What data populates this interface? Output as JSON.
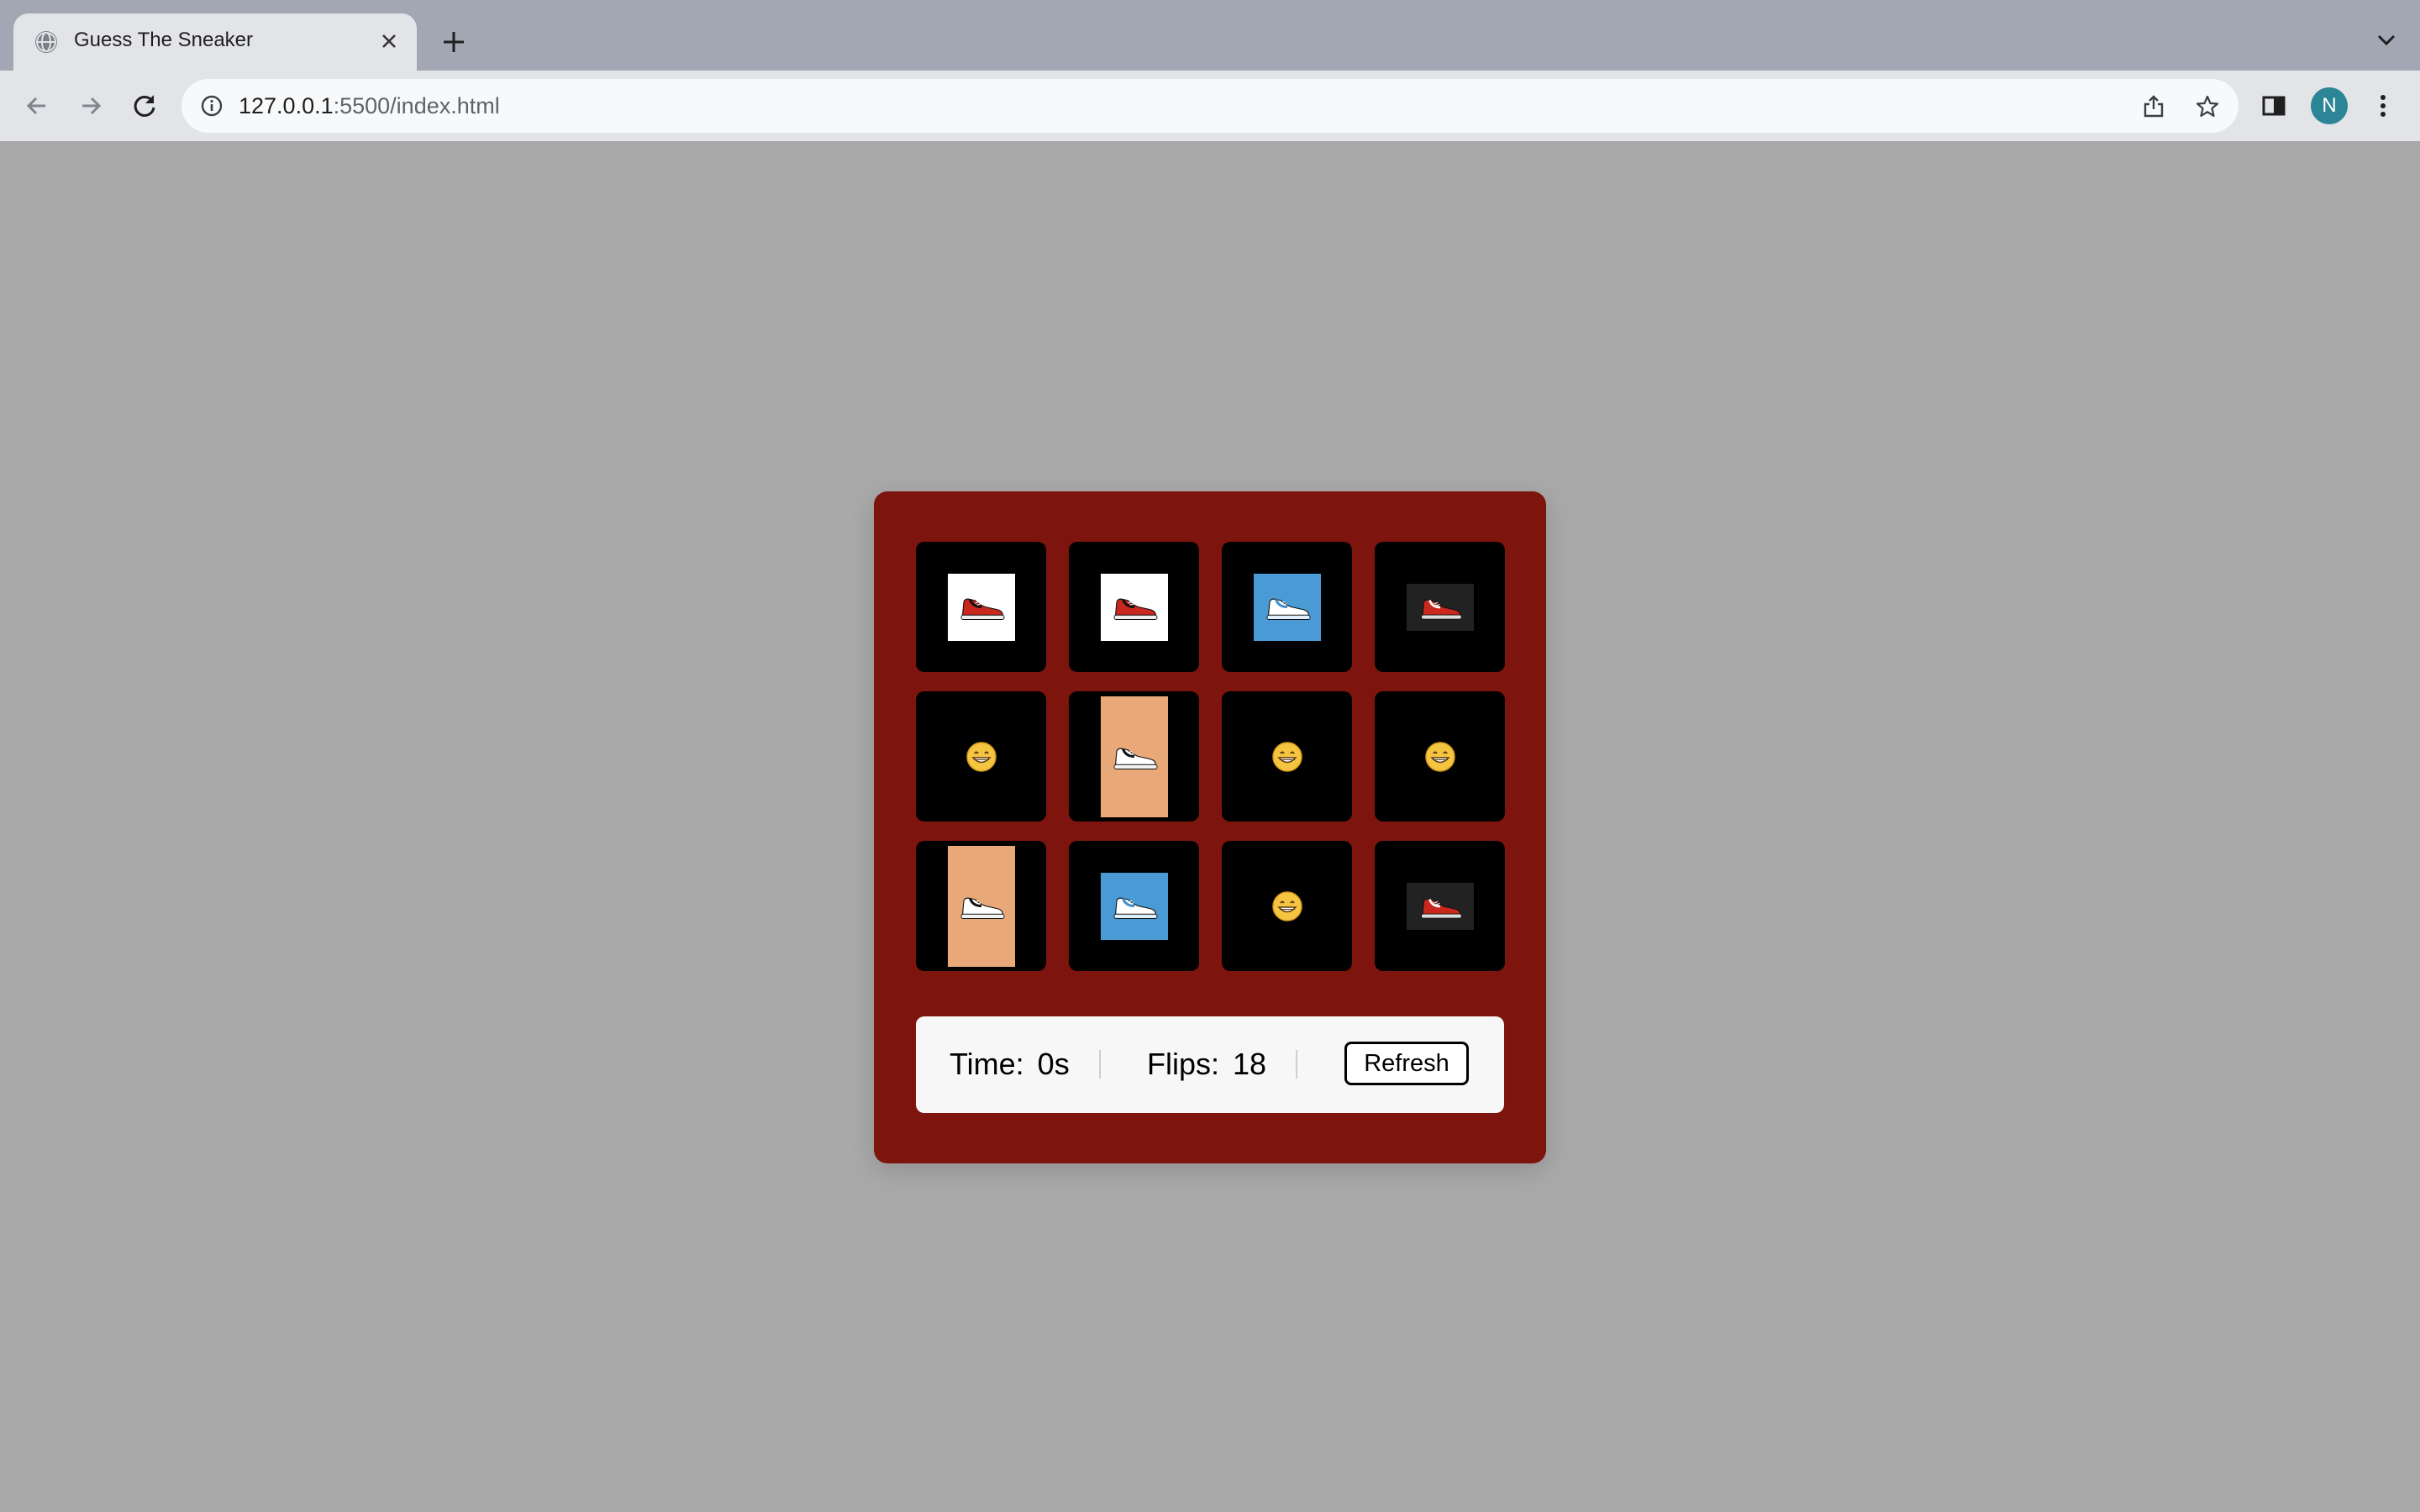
{
  "browser": {
    "tab_title": "Guess The Sneaker",
    "url_host": "127.0.0.1",
    "url_path": ":5500/index.html",
    "profile_initial": "N",
    "colors": {
      "tabstrip": "#a3a7b4",
      "toolbar": "#e3e4e8",
      "avatar": "#2c8596"
    }
  },
  "game": {
    "colors": {
      "panel": "#7d140d",
      "card_back": "#000000",
      "page_bg": "#a9a9a9"
    },
    "cards": [
      {
        "state": "revealed",
        "sneaker": "red-black-jordan-4"
      },
      {
        "state": "revealed",
        "sneaker": "red-black-jordan-4"
      },
      {
        "state": "revealed",
        "sneaker": "blue-white-jordan-1"
      },
      {
        "state": "revealed",
        "sneaker": "chicago-jordan-1-dark"
      },
      {
        "state": "hidden",
        "icon": "grinning-face-emoji"
      },
      {
        "state": "revealed",
        "sneaker": "black-white-jordan-1-orange"
      },
      {
        "state": "hidden",
        "icon": "grinning-face-emoji"
      },
      {
        "state": "hidden",
        "icon": "grinning-face-emoji"
      },
      {
        "state": "revealed",
        "sneaker": "black-white-jordan-1-orange"
      },
      {
        "state": "revealed",
        "sneaker": "blue-white-jordan-1"
      },
      {
        "state": "hidden",
        "icon": "grinning-face-emoji"
      },
      {
        "state": "revealed",
        "sneaker": "chicago-jordan-1-dark"
      }
    ],
    "stats": {
      "time_label": "Time:",
      "time_value": "0s",
      "flips_label": "Flips:",
      "flips_value": "18",
      "refresh_label": "Refresh"
    }
  }
}
